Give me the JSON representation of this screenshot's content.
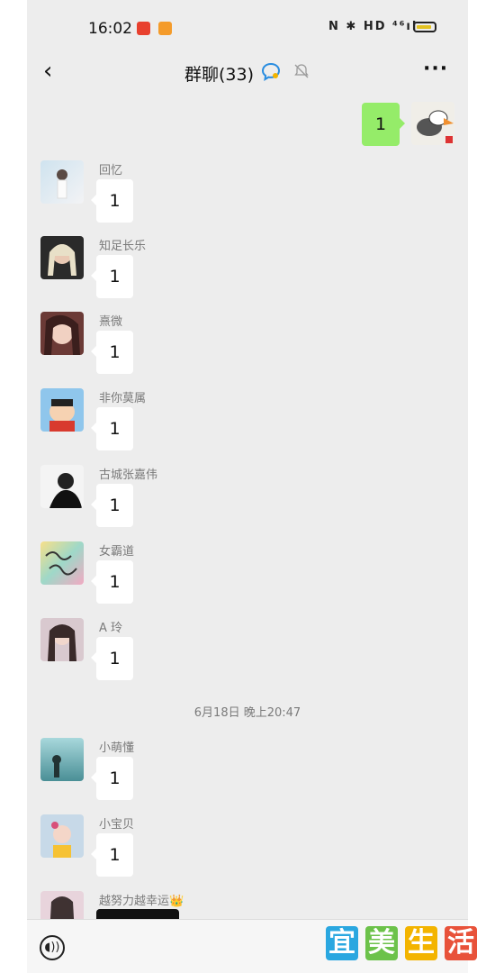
{
  "status_bar": {
    "time": "16:02",
    "icons": [
      "notification-app-icon",
      "notification-app-icon",
      "nfc-icon",
      "bluetooth-icon",
      "hd-icon",
      "signal-4g-icon",
      "battery-icon"
    ],
    "status_text": "N ✱ HD ⁴⁶ıl"
  },
  "header": {
    "back_glyph": "‹",
    "title": "群聊(33)",
    "more_glyph": "···"
  },
  "my_message": {
    "text": "1"
  },
  "messages": [
    {
      "name": "回忆",
      "text": "1"
    },
    {
      "name": "知足长乐",
      "text": "1"
    },
    {
      "name": "熹微",
      "text": "1"
    },
    {
      "name": "非你莫属",
      "text": "1"
    },
    {
      "name": "古城张嘉伟",
      "text": "1"
    },
    {
      "name": "女霸道",
      "text": "1"
    },
    {
      "name": "A 玲",
      "text": "1"
    }
  ],
  "timestamp": "6月18日 晚上20:47",
  "messages_after": [
    {
      "name": "小萌懂",
      "text": "1"
    },
    {
      "name": "小宝贝",
      "text": "1"
    },
    {
      "name": "越努力越幸运👑"
    }
  ],
  "input_bar": {
    "voice_glyph": "◖))"
  },
  "watermark": {
    "chars": [
      "宜",
      "美",
      "生",
      "活"
    ],
    "colors": [
      "#2aa7e0",
      "#6cc24a",
      "#f3b400",
      "#e8523a"
    ]
  },
  "colors": {
    "background": "#ededed",
    "my_bubble": "#95ec69",
    "other_bubble": "#ffffff"
  }
}
